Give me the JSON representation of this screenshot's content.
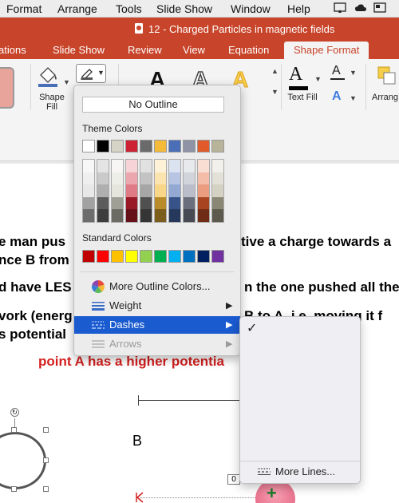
{
  "menubar": {
    "items": [
      "Format",
      "Arrange",
      "Tools",
      "Slide Show",
      "Window",
      "Help"
    ]
  },
  "window": {
    "title": "12 - Charged Particles in magnetic fields"
  },
  "ribbon_tabs": [
    "ations",
    "Slide Show",
    "Review",
    "View",
    "Equation",
    "Shape Format"
  ],
  "ribbon": {
    "shape_fill_line1": "Shape",
    "shape_fill_line2": "Fill",
    "wordart_glyph": "A",
    "text_fill_label": "Text Fill",
    "arrange_label": "Arrang"
  },
  "outline_menu": {
    "no_outline": "No Outline",
    "theme_colors_label": "Theme Colors",
    "theme_colors": [
      "#ffffff",
      "#000000",
      "#d5d4c6",
      "#cc2233",
      "#6a6a6a",
      "#f5bb38",
      "#4b6fb6",
      "#8e93a6",
      "#e05a2a",
      "#b8b49a"
    ],
    "standard_colors_label": "Standard Colors",
    "standard_colors": [
      "#c00000",
      "#ff0000",
      "#ffc000",
      "#ffff00",
      "#92d050",
      "#00b050",
      "#00b0f0",
      "#0070c0",
      "#002060",
      "#7030a0"
    ],
    "more_outline_colors": "More Outline Colors...",
    "weight": "Weight",
    "dashes": "Dashes",
    "arrows": "Arrows"
  },
  "dashes_submenu": {
    "check": "✓",
    "more_lines": "More Lines..."
  },
  "slide": {
    "line1_left": "e man pus",
    "line1_right": "tive a charge towards a",
    "line2_left": "nce B from",
    "line3_left": "d have LES",
    "line3_right": "n the one pushed all the",
    "line4_left": "vork (energ",
    "line4_right": "B to A, i.e. moving it f",
    "line5_left": "s potential",
    "red_line": "point A has a higher potentia",
    "label_b": "B",
    "small_label": "0"
  },
  "colors": {
    "accent": "#c8442a",
    "highlight": "#1a5bd0",
    "red_text": "#d42020"
  }
}
